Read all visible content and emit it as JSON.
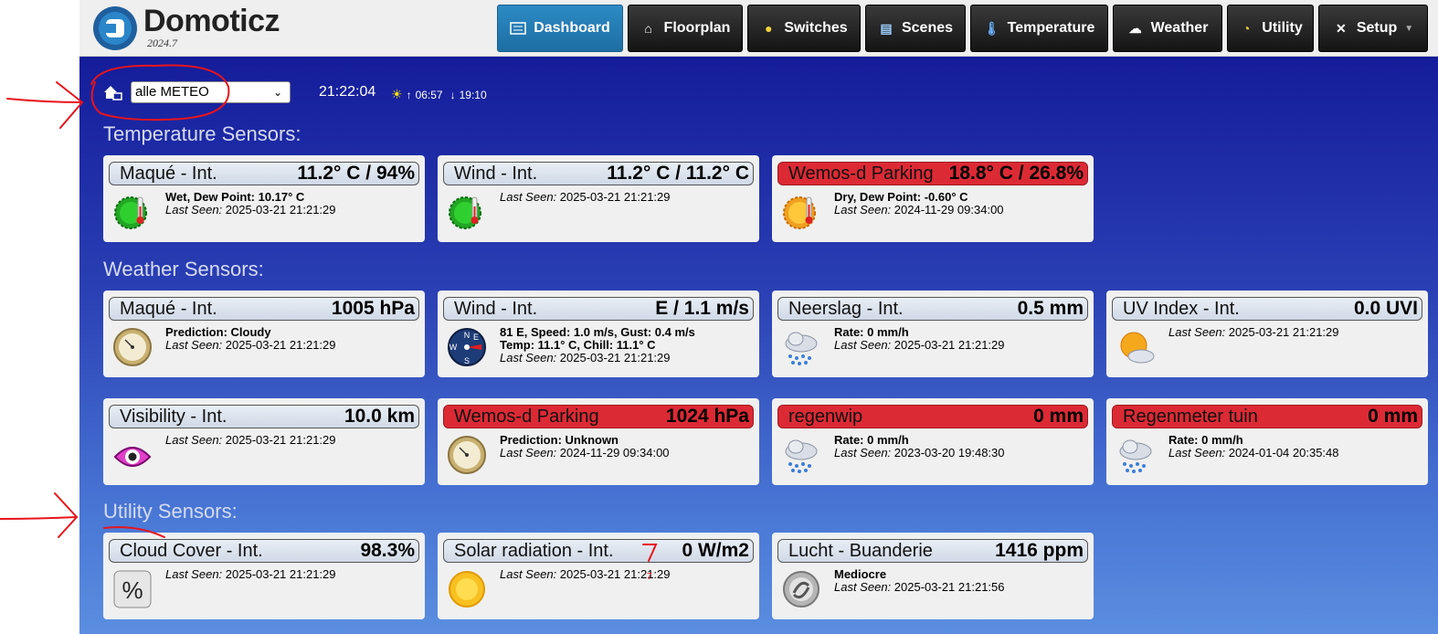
{
  "header": {
    "brand": "Domoticz",
    "version": "2024.7",
    "nav": [
      {
        "label": "Dashboard",
        "icon": "dashboard-icon",
        "active": true
      },
      {
        "label": "Floorplan",
        "icon": "house-icon"
      },
      {
        "label": "Switches",
        "icon": "lightbulb-icon"
      },
      {
        "label": "Scenes",
        "icon": "clapper-icon"
      },
      {
        "label": "Temperature",
        "icon": "thermometer-icon"
      },
      {
        "label": "Weather",
        "icon": "cloud-rain-icon"
      },
      {
        "label": "Utility",
        "icon": "gauge-icon"
      },
      {
        "label": "Setup",
        "icon": "tools-icon"
      }
    ]
  },
  "toolbar": {
    "location": "alle METEO",
    "time": "21:22:04",
    "sunrise": "06:57",
    "sunset": "19:10"
  },
  "sections": {
    "temperature": "Temperature Sensors:",
    "weather": "Weather Sensors:",
    "utility": "Utility Sensors:"
  },
  "labels": {
    "last_seen": "Last Seen:"
  },
  "temperature": [
    {
      "name": "Maqué - Int.",
      "value": "11.2° C / 94%",
      "line1": "Wet, Dew Point: 10.17° C",
      "last": "2025-03-21 21:21:29",
      "alert": false
    },
    {
      "name": "Wind - Int.",
      "value": "11.2° C / 11.2° C",
      "last": "2025-03-21 21:21:29",
      "alert": false
    },
    {
      "name": "Wemos-d Parking",
      "value": "18.8° C / 26.8%",
      "line1": "Dry, Dew Point: -0.60° C",
      "last": "2024-11-29 09:34:00",
      "alert": true
    }
  ],
  "weather": [
    {
      "name": "Maqué - Int.",
      "value": "1005 hPa",
      "line1": "Prediction: Cloudy",
      "last": "2025-03-21 21:21:29"
    },
    {
      "name": "Wind - Int.",
      "value": "E / 1.1 m/s",
      "line1": "81 E, Speed: 1.0 m/s, Gust: 0.4 m/s",
      "line2": "Temp: 11.1° C, Chill: 11.1° C",
      "last": "2025-03-21 21:21:29"
    },
    {
      "name": "Neerslag - Int.",
      "value": "0.5 mm",
      "line1": "Rate: 0 mm/h",
      "last": "2025-03-21 21:21:29"
    },
    {
      "name": "UV Index - Int.",
      "value": "0.0 UVI",
      "last": "2025-03-21 21:21:29"
    },
    {
      "name": "Visibility - Int.",
      "value": "10.0 km",
      "last": "2025-03-21 21:21:29"
    },
    {
      "name": "Wemos-d Parking",
      "value": "1024 hPa",
      "line1": "Prediction: Unknown",
      "last": "2024-11-29 09:34:00"
    },
    {
      "name": "regenwip",
      "value": "0 mm",
      "line1": "Rate: 0 mm/h",
      "last": "2023-03-20 19:48:30"
    },
    {
      "name": "Regenmeter tuin",
      "value": "0 mm",
      "line1": "Rate: 0 mm/h",
      "last": "2024-01-04 20:35:48"
    }
  ],
  "utility": [
    {
      "name": "Cloud Cover - Int.",
      "value": "98.3%",
      "last": "2025-03-21 21:21:29"
    },
    {
      "name": "Solar radiation - Int.",
      "value": "0 W/m2",
      "last": "2025-03-21 21:21:29"
    },
    {
      "name": "Lucht - Buanderie",
      "value": "1416 ppm",
      "line1": "Mediocre",
      "last": "2025-03-21 21:21:56"
    }
  ],
  "compass_letters": {
    "n": "N",
    "e": "E",
    "s": "S",
    "w": "W"
  },
  "percent_symbol": "%",
  "annotation_mark": "7"
}
